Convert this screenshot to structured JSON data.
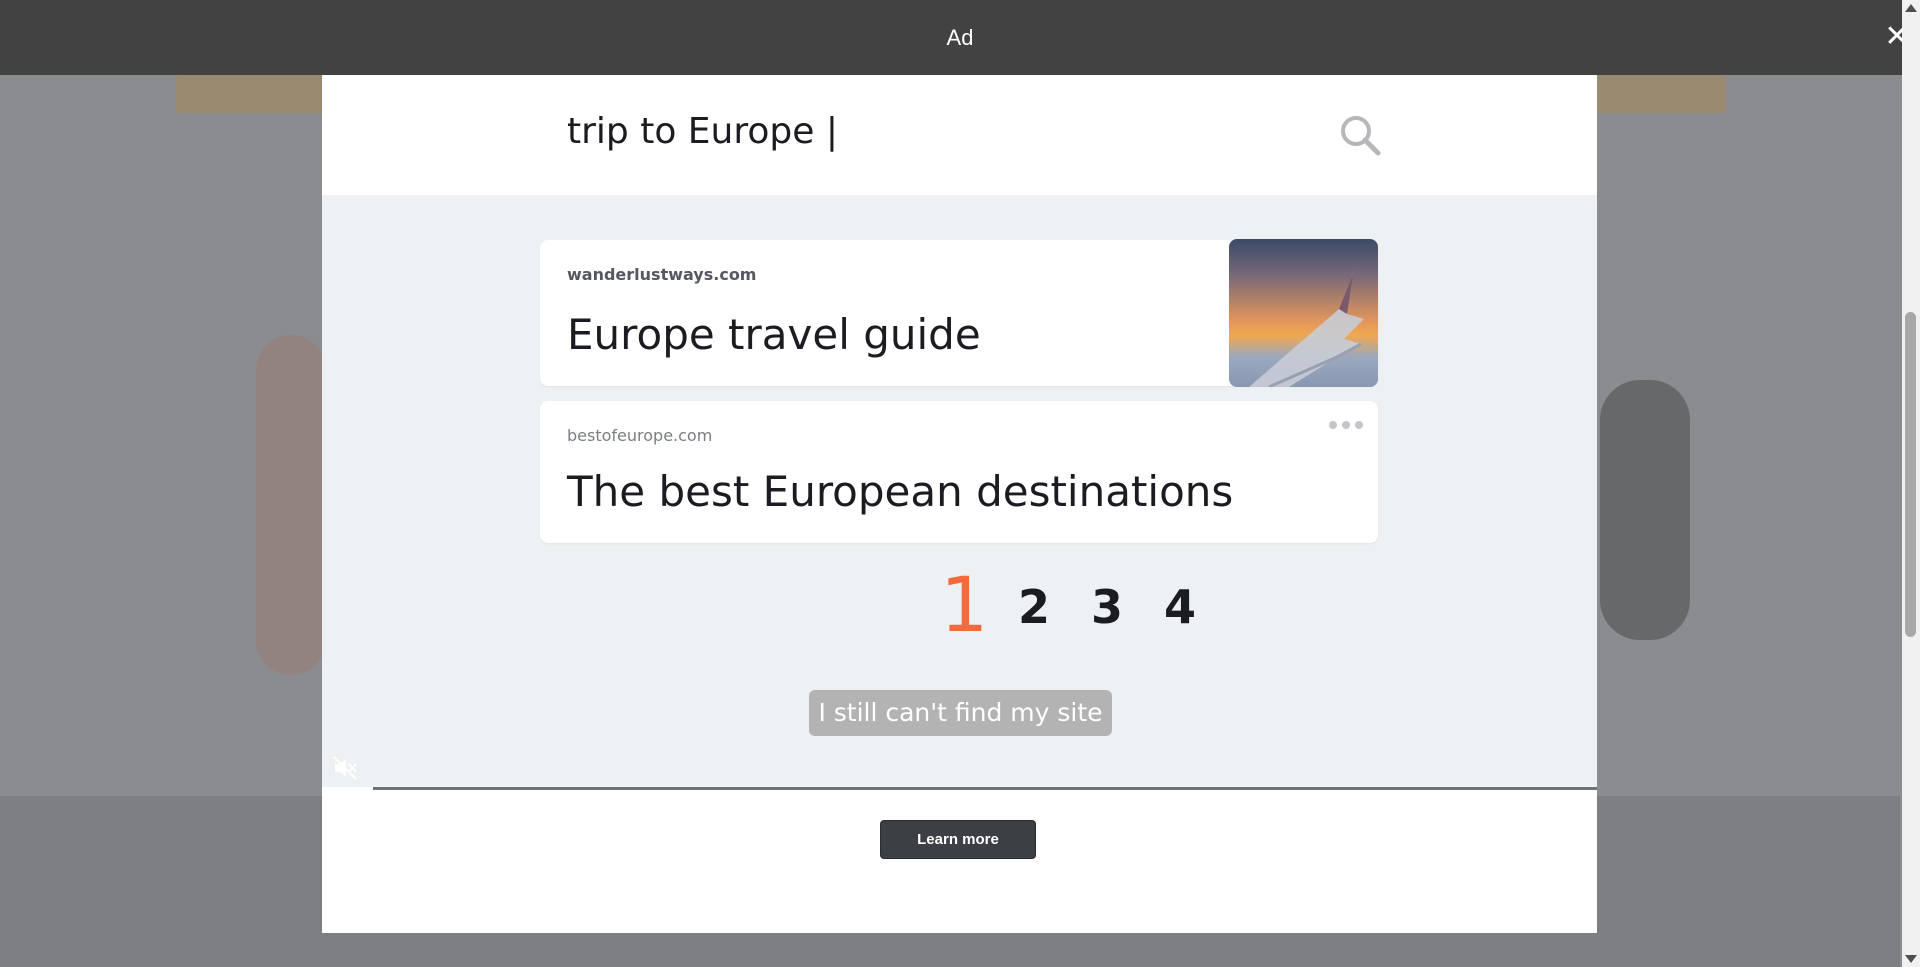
{
  "ad_bar": {
    "label": "Ad"
  },
  "search": {
    "query": "trip to Europe |"
  },
  "results": [
    {
      "domain": "wanderlustways.com",
      "title": "Europe travel guide"
    },
    {
      "domain": "bestofeurope.com",
      "title": "The best European destinations"
    }
  ],
  "pager": {
    "pages": [
      "1",
      "2",
      "3",
      "4"
    ],
    "active": "1"
  },
  "cant_find_label": "I still can't find my site",
  "learn_more_label": "Learn more",
  "video_progress": 0.04,
  "colors": {
    "accent_orange": "#f36b3c",
    "ad_bar": "#424242",
    "learn_more_bg": "#3c3f44",
    "video_bg": "#eef1f3"
  },
  "icons": {
    "close": "close-icon",
    "search": "search-icon",
    "more": "more-horizontal-icon",
    "mute": "muted-speaker-icon"
  }
}
